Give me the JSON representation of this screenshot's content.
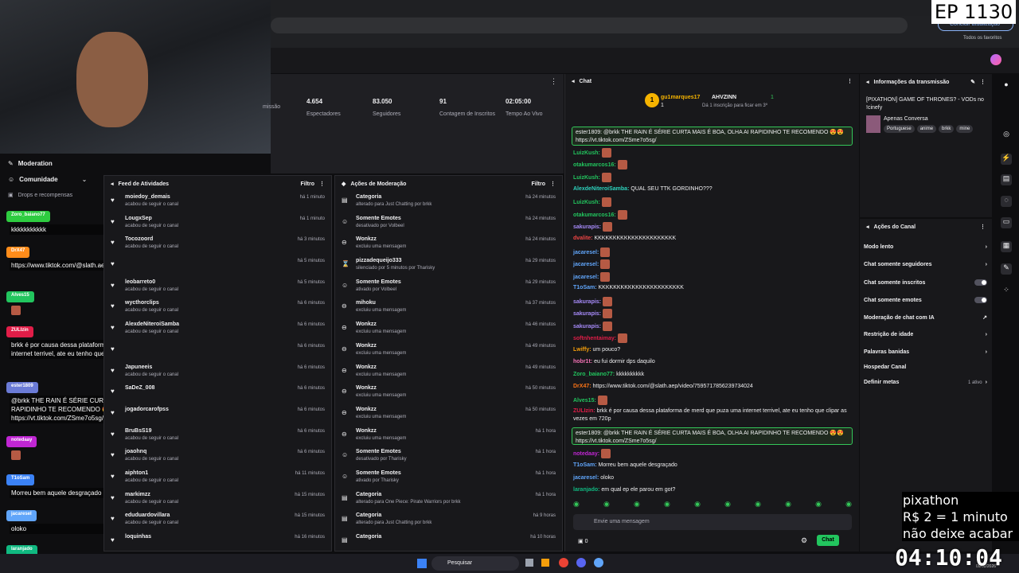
{
  "overlay": {
    "episode": "EP 1130",
    "pix_lines": [
      "pixathon",
      "R$ 2 = 1 minuto",
      "não deixe acabar"
    ],
    "timer": "04:10:04"
  },
  "browser": {
    "update_label": "Concluir atualização",
    "bookmarks_all": "Todos os favoritos"
  },
  "left": {
    "moderation": "Moderation",
    "community": "Comunidade",
    "drops": "Drops e recompensas",
    "chat": [
      {
        "name": "Zoro_baiano77",
        "color": "#2ecc40",
        "text": "kkkkkkkkkkk"
      },
      {
        "name": "DrX47",
        "color": "#ff8c1a",
        "text": "https://www.tiktok.com/@slath.aep/video/7595717856239734024"
      },
      {
        "name": "Alves15",
        "color": "#22c55e",
        "text": ""
      },
      {
        "name": "ZULIzin",
        "color": "#e11d48",
        "text": "brkk é por causa dessa plataforma de merd que puza uma internet terrivel, ate eu tenho que clipar as vezes em 720p"
      },
      {
        "name": "ester1809",
        "color": "#6b7bd6",
        "text": "@brkk THE RAIN É SÉRIE CURTA MAIS É BOA, OLHA AI RAPIDINHO TE RECOMENDO 😍😍 https://vt.tiktok.com/ZSme7o5sg/"
      },
      {
        "name": "notedaay",
        "color": "#c026d3",
        "text": ""
      },
      {
        "name": "T1oSam",
        "color": "#3b82f6",
        "text": "Morreu bem aquele desgraçado"
      },
      {
        "name": "jacaresel",
        "color": "#60a5fa",
        "text": "oloko"
      },
      {
        "name": "laranjado",
        "color": "#10b981",
        "text": "em qual ep ele parou em got?"
      }
    ]
  },
  "stats": {
    "items": [
      {
        "value": "",
        "label": "missão"
      },
      {
        "value": "4.654",
        "label": "Espectadores"
      },
      {
        "value": "83.050",
        "label": "Seguidores"
      },
      {
        "value": "91",
        "label": "Contagem de Inscritos"
      },
      {
        "value": "02:05:00",
        "label": "Tempo Ao Vivo"
      }
    ]
  },
  "feed": {
    "title": "Feed de Atividades",
    "filter": "Filtro",
    "items": [
      {
        "name": "moiedoy_demais",
        "sub": "acabou de seguir o canal",
        "time": "há 1 minuto"
      },
      {
        "name": "LougxSep",
        "sub": "acabou de seguir o canal",
        "time": "há 1 minuto"
      },
      {
        "name": "Tocozoord",
        "sub": "acabou de seguir o canal",
        "time": "há 3 minutos"
      },
      {
        "name": "",
        "sub": "",
        "time": "há 5 minutos"
      },
      {
        "name": "leobarreto0",
        "sub": "acabou de seguir o canal",
        "time": "há 5 minutos"
      },
      {
        "name": "wycthorclips",
        "sub": "acabou de seguir o canal",
        "time": "há 6 minutos"
      },
      {
        "name": "AlexdeNiteroiSamba",
        "sub": "acabou de seguir o canal",
        "time": "há 6 minutos"
      },
      {
        "name": "",
        "sub": "",
        "time": "há 6 minutos"
      },
      {
        "name": "Japuneeis",
        "sub": "acabou de seguir o canal",
        "time": "há 6 minutos"
      },
      {
        "name": "SaDeZ_008",
        "sub": "",
        "time": "há 6 minutos"
      },
      {
        "name": "jogadorcarofpss",
        "sub": "",
        "time": "há 6 minutos"
      },
      {
        "name": "BruBsS19",
        "sub": "acabou de seguir o canal",
        "time": "há 6 minutos"
      },
      {
        "name": "joaohnq",
        "sub": "acabou de seguir o canal",
        "time": "há 6 minutos"
      },
      {
        "name": "aiphton1",
        "sub": "acabou de seguir o canal",
        "time": "há 11 minutos"
      },
      {
        "name": "markimzz",
        "sub": "acabou de seguir o canal",
        "time": "há 15 minutos"
      },
      {
        "name": "eduduardovillara",
        "sub": "acabou de seguir o canal",
        "time": "há 15 minutos"
      },
      {
        "name": "loquinhas",
        "sub": "",
        "time": "há 16 minutos"
      }
    ]
  },
  "mod": {
    "title": "Ações de Moderação",
    "filter": "Filtro",
    "items": [
      {
        "name": "Categoria",
        "sub": "alterado para Just Chatting por brkk",
        "time": "há 24 minutos",
        "icon": "▤"
      },
      {
        "name": "Somente Emotes",
        "sub": "desativado por Volbeel",
        "time": "há 24 minutos",
        "icon": "☺"
      },
      {
        "name": "Wonkzz",
        "sub": "excluiu uma mensagem",
        "time": "há 24 minutos",
        "icon": "⊖"
      },
      {
        "name": "pizzadequeijo333",
        "sub": "silenciado por 5 minutos por Tharisky",
        "time": "há 29 minutos",
        "icon": "⌛"
      },
      {
        "name": "Somente Emotes",
        "sub": "ativado por Volbeel",
        "time": "há 29 minutos",
        "icon": "☺"
      },
      {
        "name": "mihoku",
        "sub": "excluiu uma mensagem",
        "time": "há 37 minutos",
        "icon": "⊖"
      },
      {
        "name": "Wonkzz",
        "sub": "excluiu uma mensagem",
        "time": "há 46 minutos",
        "icon": "⊖"
      },
      {
        "name": "Wonkzz",
        "sub": "excluiu uma mensagem",
        "time": "há 49 minutos",
        "icon": "⊖"
      },
      {
        "name": "Wonkzz",
        "sub": "excluiu uma mensagem",
        "time": "há 49 minutos",
        "icon": "⊖"
      },
      {
        "name": "Wonkzz",
        "sub": "excluiu uma mensagem",
        "time": "há 50 minutos",
        "icon": "⊖"
      },
      {
        "name": "Wonkzz",
        "sub": "excluiu uma mensagem",
        "time": "há 50 minutos",
        "icon": "⊖"
      },
      {
        "name": "Wonkzz",
        "sub": "excluiu uma mensagem",
        "time": "há 1 hora",
        "icon": "⊖"
      },
      {
        "name": "Somente Emotes",
        "sub": "desativado por Tharisky",
        "time": "há 1 hora",
        "icon": "☺"
      },
      {
        "name": "Somente Emotes",
        "sub": "ativado por Tharisky",
        "time": "há 1 hora",
        "icon": "☺"
      },
      {
        "name": "Categoria",
        "sub": "alterado para One Piece: Pirate Warriors por brkk",
        "time": "há 1 hora",
        "icon": "▤"
      },
      {
        "name": "Categoria",
        "sub": "alterado para Just Chatting por brkk",
        "time": "há 9 horas",
        "icon": "▤"
      },
      {
        "name": "Categoria",
        "sub": "",
        "time": "há 10 horas",
        "icon": "▤"
      }
    ]
  },
  "chat": {
    "title": "Chat",
    "top_gifter": "gu1marques17",
    "top_count": "1",
    "top_user2": "AHVZINN",
    "top_count2": "1",
    "sub_note": "Dá 1 inscrição para ficar em 3º",
    "messages": [
      {
        "name": "LuizKush:",
        "color": "#22c55e",
        "text": ""
      },
      {
        "name": "otakumarcos16:",
        "color": "#22c55e",
        "text": ""
      },
      {
        "name": "LuizKush:",
        "color": "#22c55e",
        "text": ""
      },
      {
        "name": "AlexdeNiteroiSamba:",
        "color": "#2dd4bf",
        "text": "QUAL SEU TTK GORDINHO???"
      },
      {
        "name": "LuizKush:",
        "color": "#22c55e",
        "text": ""
      },
      {
        "name": "otakumarcos16:",
        "color": "#22c55e",
        "text": ""
      },
      {
        "name": "sakurapis:",
        "color": "#a78bfa",
        "text": ""
      },
      {
        "name": "dvalite:",
        "color": "#ef4444",
        "text": "KKKKKKKKKKKKKKKKKKKKKK"
      },
      {
        "name": "jacaresel:",
        "color": "#60a5fa",
        "text": ""
      },
      {
        "name": "jacaresel:",
        "color": "#60a5fa",
        "text": ""
      },
      {
        "name": "jacaresel:",
        "color": "#60a5fa",
        "text": ""
      },
      {
        "name": "T1oSam:",
        "color": "#60a5fa",
        "text": "KKKKKKKKKKKKKKKKKKKKKKK"
      },
      {
        "name": "sakurapis:",
        "color": "#a78bfa",
        "text": ""
      },
      {
        "name": "sakurapis:",
        "color": "#a78bfa",
        "text": ""
      },
      {
        "name": "sakurapis:",
        "color": "#a78bfa",
        "text": ""
      },
      {
        "name": "softnhentaimay:",
        "color": "#e11d48",
        "text": ""
      },
      {
        "name": "Lwiffy:",
        "color": "#f59e0b",
        "text": "um pouco?"
      },
      {
        "name": "hobr1t:",
        "color": "#f472b6",
        "text": "eu fui dormir dps daquilo"
      },
      {
        "name": "Zoro_baiano77:",
        "color": "#22c55e",
        "text": "kkkkkkkkkk"
      },
      {
        "name": "DrX47:",
        "color": "#f97316",
        "text": "https://www.tiktok.com/@slath.aep/video/7595717856239734024"
      },
      {
        "name": "Alves15:",
        "color": "#22c55e",
        "text": ""
      },
      {
        "name": "ZULIzin:",
        "color": "#e11d48",
        "text": "brkk é por causa dessa plataforma de merd que puza uma internet terrivel, ate eu tenho que clipar as vezes em 720p"
      }
    ],
    "highlight_top": "ester1809: @brkk THE RAIN É SÉRIE CURTA MAIS É BOA, OLHA AI RAPIDINHO TE RECOMENDO 😍😍 https://vt.tiktok.com/ZSme7o5sg/",
    "highlight_bottom": "ester1809: @brkk THE RAIN É SÉRIE CURTA MAIS É BOA, OLHA AI RAPIDINHO TE RECOMENDO 😍😍 https://vt.tiktok.com/ZSme7o5sg/",
    "after": [
      {
        "name": "notedaay:",
        "color": "#c026d3",
        "text": ""
      },
      {
        "name": "T1oSam:",
        "color": "#60a5fa",
        "text": "Morreu bem aquele desgraçado"
      },
      {
        "name": "jacaresel:",
        "color": "#60a5fa",
        "text": "oloko"
      },
      {
        "name": "laranjado:",
        "color": "#10b981",
        "text": "em qual ep ele parou em got?"
      }
    ],
    "placeholder": "Envie uma mensagem",
    "points": "0",
    "send_label": "Chat"
  },
  "info": {
    "title": "Informações da transmissão",
    "stream_title": "[PIXATHON] GAME OF THRONES? - VODs no !cinefy",
    "category": "Apenas Conversa",
    "tags": [
      "Portuguese",
      "anime",
      "brkk",
      "mine"
    ]
  },
  "actions": {
    "title": "Ações do Canal",
    "rows": [
      {
        "label": "Modo lento",
        "kind": "arrow"
      },
      {
        "label": "Chat somente seguidores",
        "kind": "arrow"
      },
      {
        "label": "Chat somente inscritos",
        "kind": "toggle"
      },
      {
        "label": "Chat somente emotes",
        "kind": "toggle"
      },
      {
        "label": "Moderação de chat com IA",
        "kind": "link"
      },
      {
        "label": "Restrição de idade",
        "kind": "arrow"
      },
      {
        "label": "Palavras banidas",
        "kind": "arrow"
      },
      {
        "label": "Hospedar Canal",
        "kind": "none"
      },
      {
        "label": "Definir metas",
        "kind": "arrow",
        "extra": "1 ativo"
      }
    ]
  },
  "taskbar": {
    "search": "Pesquisar",
    "date": "09/02/2026"
  }
}
